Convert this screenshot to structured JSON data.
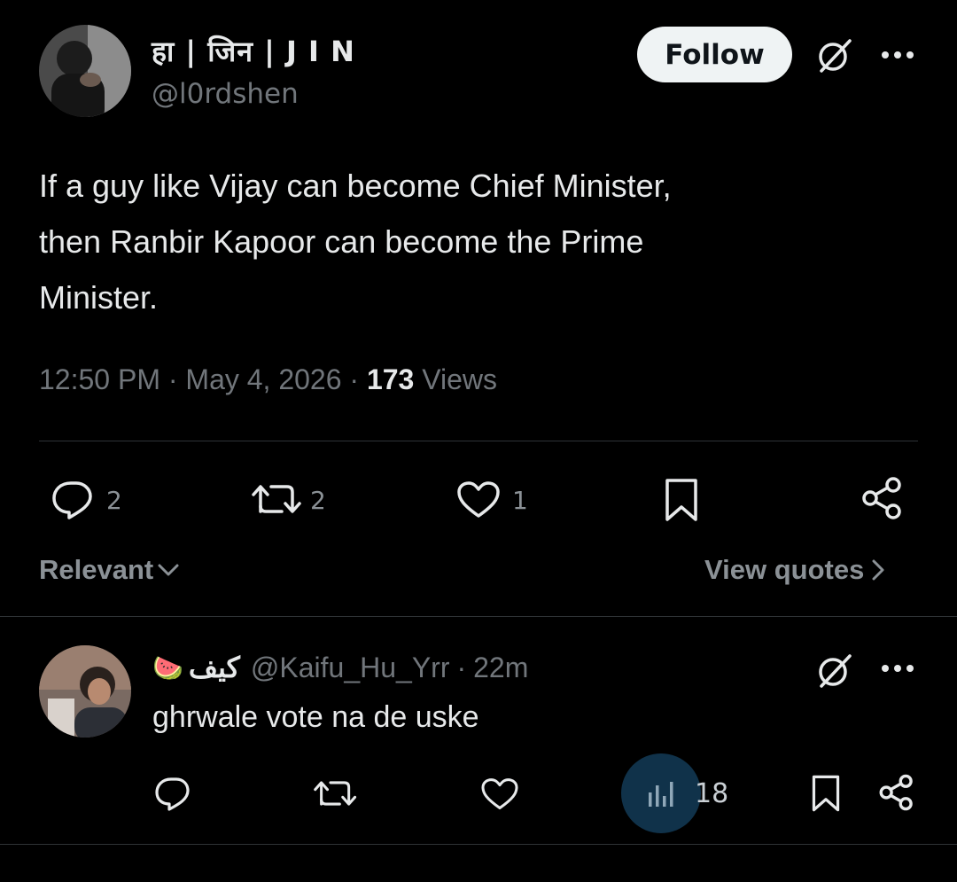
{
  "tweet": {
    "display_name": "हा | जिन | J I N",
    "handle": "@l0rdshen",
    "follow_label": "Follow",
    "more_icon": "more-icon",
    "text_lines": [
      "If a guy like  Vijay can become Chief Minister,",
      "then Ranbir Kapoor can become the Prime",
      "Minister."
    ],
    "time": "12:50 PM",
    "date": "May 4, 2026",
    "sep": "·",
    "views_count": "173",
    "views_label": "Views",
    "reply_count": "2",
    "retweet_count": "2",
    "like_count": "1"
  },
  "filters": {
    "sort_label": "Relevant",
    "view_quotes_label": "View quotes"
  },
  "reply": {
    "display_name": "كيف",
    "emoji": "🍉",
    "handle": "@Kaifu_Hu_Yrr",
    "age": "22m",
    "text": "ghrwale vote na de uske",
    "views_count": "18"
  },
  "colors": {
    "background": "#000000",
    "text": "#e7e9ea",
    "muted": "#71767b",
    "divider": "#2f3336",
    "follow_bg": "#eff3f4",
    "analytics_circle": "#10324a"
  }
}
